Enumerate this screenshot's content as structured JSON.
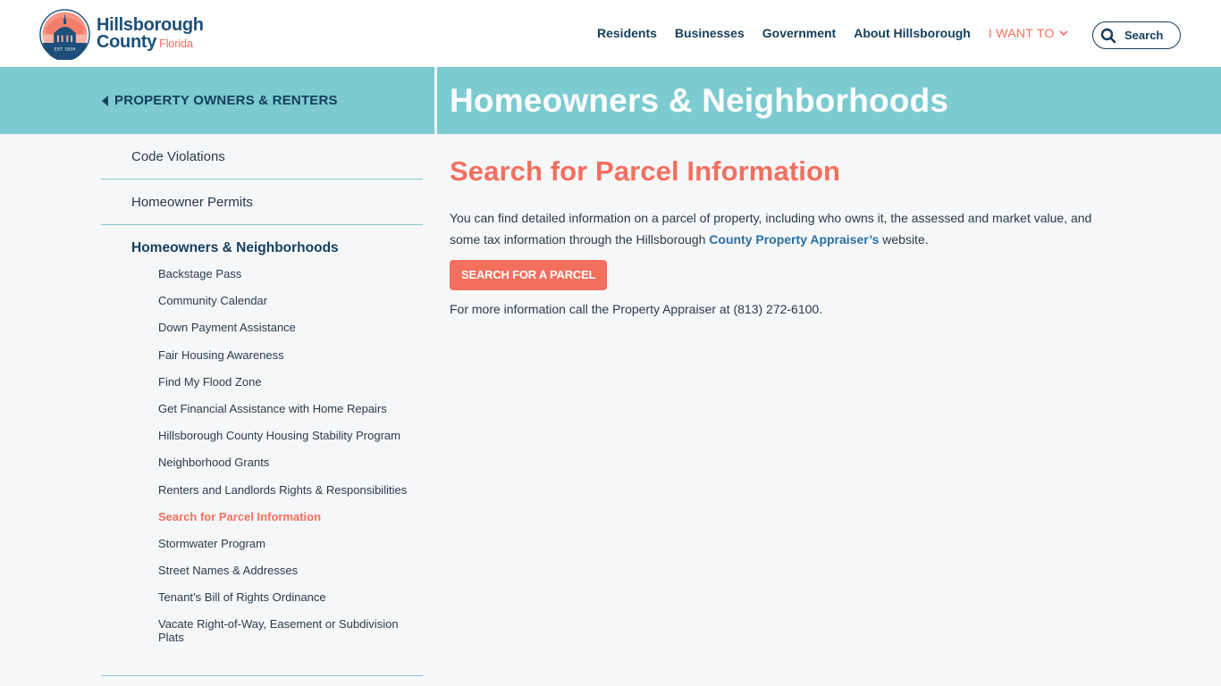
{
  "header": {
    "logo": {
      "line1": "Hillsborough",
      "line2": "County",
      "state": "Florida",
      "seal_text": "EST. 1834"
    },
    "nav": [
      {
        "label": "Residents"
      },
      {
        "label": "Businesses"
      },
      {
        "label": "Government"
      },
      {
        "label": "About Hillsborough"
      },
      {
        "label": "I WANT TO",
        "icon": "chevron-down-icon"
      }
    ],
    "search": {
      "label": "Search",
      "icon": "search-icon"
    }
  },
  "banner": {
    "back_label": "PROPERTY OWNERS & RENTERS",
    "page_title": "Homeowners & Neighborhoods"
  },
  "sidebar": {
    "top_items": [
      {
        "label": "Code Violations"
      },
      {
        "label": "Homeowner Permits"
      }
    ],
    "section": {
      "title": "Homeowners & Neighborhoods",
      "items": [
        {
          "label": "Backstage Pass"
        },
        {
          "label": "Community Calendar"
        },
        {
          "label": "Down Payment Assistance"
        },
        {
          "label": "Fair Housing Awareness"
        },
        {
          "label": "Find My Flood Zone"
        },
        {
          "label": "Get Financial Assistance with Home Repairs"
        },
        {
          "label": "Hillsborough County Housing Stability Program"
        },
        {
          "label": "Neighborhood Grants"
        },
        {
          "label": "Renters and Landlords Rights & Responsibilities"
        },
        {
          "label": "Search for Parcel Information",
          "active": true
        },
        {
          "label": "Stormwater Program"
        },
        {
          "label": "Street Names & Addresses"
        },
        {
          "label": "Tenant’s Bill of Rights Ordinance"
        },
        {
          "label": "Vacate Right-of-Way, Easement or Subdivision Plats"
        }
      ]
    }
  },
  "main": {
    "heading": "Search for Parcel Information",
    "intro_before": "You can find detailed information on a parcel of property, including who owns it, the assessed and market value, and some tax information through the Hillsborough ",
    "intro_link": "County Property Appraiser’s",
    "intro_after": " website.",
    "cta_label": "SEARCH FOR A PARCEL",
    "more_info": "For more information call the Property Appraiser at (813) 272-6100."
  },
  "colors": {
    "navy": "#153e5c",
    "coral": "#f36f5e",
    "teal": "#7ccbd1",
    "link_blue": "#2b6ea6",
    "background": "#f5f7f9"
  }
}
